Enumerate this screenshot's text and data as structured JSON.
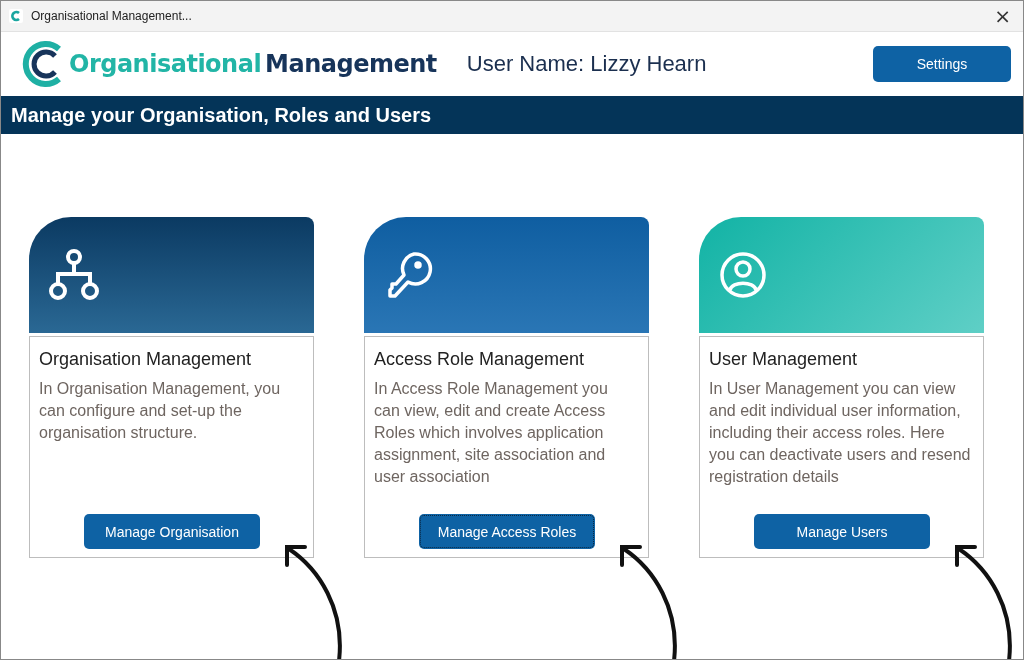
{
  "window": {
    "title": "Organisational Management...",
    "close": "×"
  },
  "header": {
    "logo_part_1": "Organisational",
    "logo_part_2": "Management",
    "user_name": "User Name: Lizzy Hearn",
    "settings_button": "Settings"
  },
  "banner": {
    "title": "Manage your Organisation, Roles and Users"
  },
  "cards": [
    {
      "kind": "organisation",
      "title": "Organisation Management",
      "description": "In Organisation Management, you can configure and set-up the organisation structure.",
      "button": "Manage Organisation",
      "focused": false
    },
    {
      "kind": "access",
      "title": "Access Role Management",
      "description": "In Access Role Management you can view, edit and create Access Roles which involves application assignment, site association and user association",
      "button": "Manage Access Roles",
      "focused": true
    },
    {
      "kind": "user",
      "title": "User Management",
      "description": "In User Management you can view and edit  individual user information, including their access roles. Here you can deactivate users and resend registration details",
      "button": "Manage Users",
      "focused": false
    }
  ]
}
